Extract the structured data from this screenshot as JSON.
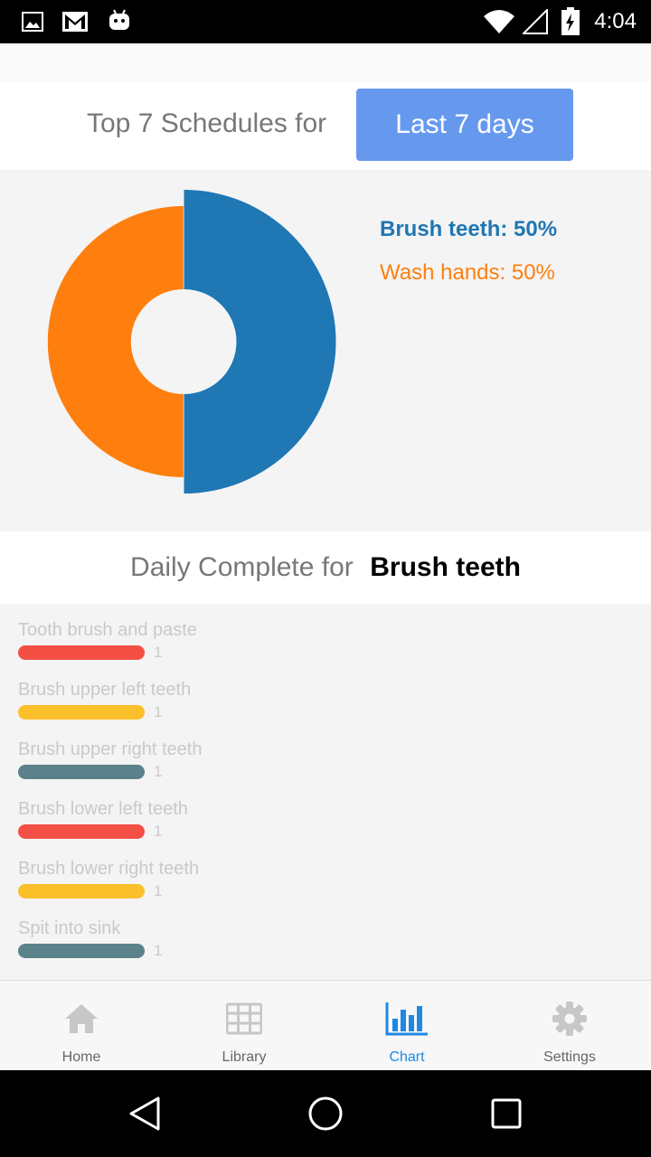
{
  "status_bar": {
    "time": "4:04",
    "icons": [
      "image-icon",
      "gmail-icon",
      "android-icon",
      "wifi-icon",
      "signal-icon",
      "battery-icon"
    ]
  },
  "header": {
    "label": "Top 7 Schedules for",
    "range_button": "Last 7 days"
  },
  "chart_data": {
    "type": "pie",
    "categories": [
      "Brush teeth",
      "Wash hands"
    ],
    "values": [
      50,
      50
    ],
    "legend": [
      "Brush teeth: 50%",
      "Wash hands: 50%"
    ],
    "colors": [
      "#1f77b4",
      "#ff7f0e"
    ],
    "selected": "Brush teeth",
    "legend_position": "right"
  },
  "daily": {
    "label": "Daily Complete for",
    "value": "Brush teeth"
  },
  "steps": [
    {
      "label": "Tooth brush and paste",
      "count": "1",
      "color": "#f44f44"
    },
    {
      "label": "Brush upper left teeth",
      "count": "1",
      "color": "#fbbf2a"
    },
    {
      "label": "Brush upper right teeth",
      "count": "1",
      "color": "#5b818a"
    },
    {
      "label": "Brush lower left teeth",
      "count": "1",
      "color": "#f44f44"
    },
    {
      "label": "Brush lower right teeth",
      "count": "1",
      "color": "#fbbf2a"
    },
    {
      "label": "Spit into sink",
      "count": "1",
      "color": "#5b818a"
    }
  ],
  "bottom_nav": {
    "items": [
      {
        "label": "Home",
        "icon": "home-icon"
      },
      {
        "label": "Library",
        "icon": "grid-icon"
      },
      {
        "label": "Chart",
        "icon": "bar-chart-icon",
        "active": true
      },
      {
        "label": "Settings",
        "icon": "gear-icon"
      }
    ],
    "active_color": "#1e88e5"
  },
  "system_nav": [
    "back-icon",
    "home-circle-icon",
    "recents-icon"
  ]
}
